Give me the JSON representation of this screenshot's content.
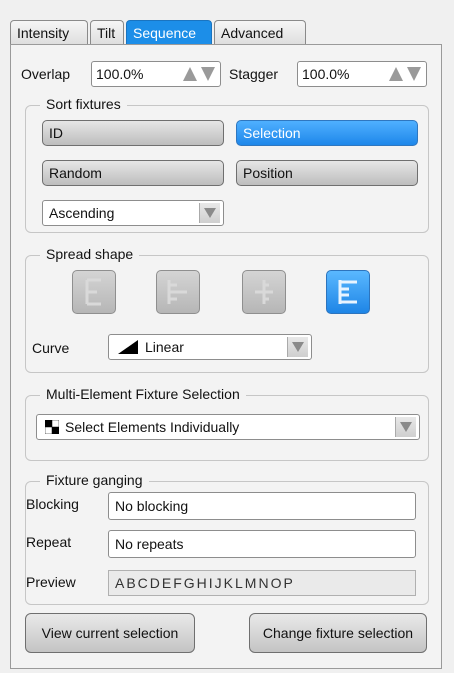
{
  "tabs": [
    {
      "label": "Intensity"
    },
    {
      "label": "Tilt"
    },
    {
      "label": "Sequence"
    },
    {
      "label": "Advanced"
    }
  ],
  "active_tab": "Sequence",
  "overlap": {
    "label": "Overlap",
    "value": "100.0%"
  },
  "stagger": {
    "label": "Stagger",
    "value": "100.0%"
  },
  "sort_fixtures": {
    "title": "Sort fixtures",
    "buttons": [
      {
        "label": "ID",
        "selected": false
      },
      {
        "label": "Selection",
        "selected": true
      },
      {
        "label": "Random",
        "selected": false
      },
      {
        "label": "Position",
        "selected": false
      }
    ],
    "order": "Ascending"
  },
  "spread_shape": {
    "title": "Spread shape",
    "shapes": [
      {
        "icon": "spread-shape-1-icon",
        "selected": false
      },
      {
        "icon": "spread-shape-2-icon",
        "selected": false
      },
      {
        "icon": "spread-shape-3-icon",
        "selected": false
      },
      {
        "icon": "spread-shape-4-icon",
        "selected": true
      }
    ],
    "curve_label": "Curve",
    "curve_value": "Linear"
  },
  "multi_element": {
    "title": "Multi-Element Fixture Selection",
    "value": "Select Elements Individually"
  },
  "fixture_ganging": {
    "title": "Fixture ganging",
    "blocking_label": "Blocking",
    "blocking_value": "No blocking",
    "repeat_label": "Repeat",
    "repeat_value": "No repeats",
    "preview_label": "Preview",
    "preview_value": "ABCDEFGHIJKLMNOP"
  },
  "bottom_buttons": {
    "view": "View current selection",
    "change": "Change fixture selection"
  },
  "colors": {
    "accent": "#1c8ee8",
    "panel": "#f3f3f3",
    "button_gray": "#c8c8c8"
  }
}
